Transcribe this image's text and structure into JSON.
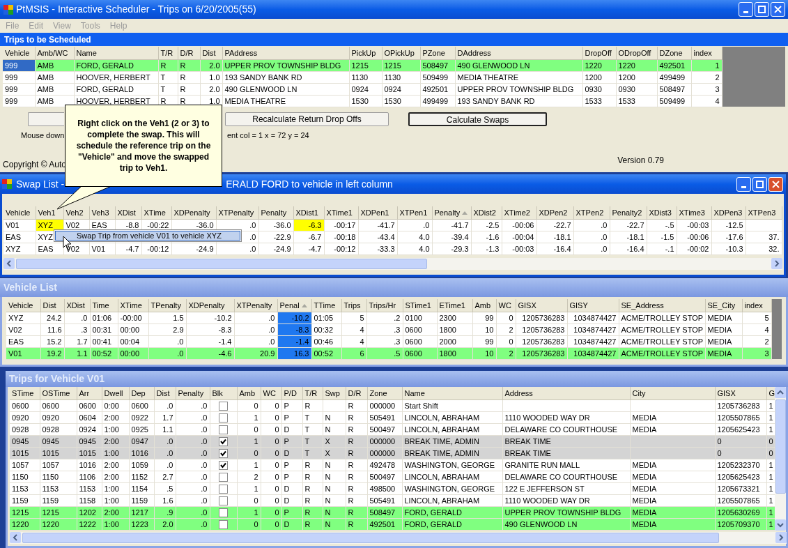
{
  "window": {
    "title": "PtMSIS - Interactive Scheduler - Trips on 6/20/2005(55)"
  },
  "menu": [
    "File",
    "Edit",
    "View",
    "Tools",
    "Help"
  ],
  "trips_to_schedule": {
    "title": "Trips to be Scheduled",
    "columns": [
      "Vehicle",
      "Amb/WC",
      "Name",
      "T/R",
      "D/R",
      "Dist",
      "PAddress",
      "PickUp",
      "OPickUp",
      "PZone",
      "DAddress",
      "DropOff",
      "ODropOff",
      "DZone",
      "index"
    ],
    "rows": [
      {
        "selected": true,
        "cells": [
          "999",
          "AMB",
          "FORD, GERALD",
          "R",
          "R",
          "2.0",
          "UPPER PROV TOWNSHIP BLDG",
          "1215",
          "1215",
          "508497",
          "490 GLENWOOD LN",
          "1220",
          "1220",
          "492501",
          "1"
        ]
      },
      {
        "selected": false,
        "cells": [
          "999",
          "AMB",
          "HOOVER, HERBERT",
          "T",
          "R",
          "1.0",
          "193 SANDY BANK RD",
          "1130",
          "1130",
          "509499",
          "MEDIA THEATRE",
          "1200",
          "1200",
          "499499",
          "2"
        ]
      },
      {
        "selected": false,
        "cells": [
          "999",
          "AMB",
          "FORD, GERALD",
          "T",
          "R",
          "2.0",
          "490 GLENWOOD LN",
          "0924",
          "0924",
          "492501",
          "UPPER PROV TOWNSHIP BLDG",
          "0930",
          "0930",
          "508497",
          "3"
        ]
      },
      {
        "selected": false,
        "cells": [
          "999",
          "AMB",
          "HOOVER, HERBERT",
          "R",
          "R",
          "1.0",
          "MEDIA THEATRE",
          "1530",
          "1530",
          "499499",
          "193 SANDY BANK RD",
          "1533",
          "1533",
          "509499",
          "4"
        ]
      }
    ]
  },
  "buttons": [
    {
      "label": "Recalculate Return Drop Offs",
      "default": false
    },
    {
      "label": "Calculate Swaps",
      "default": true
    }
  ],
  "status_text": [
    "Mouse down",
    "ent col = 1 x = 72 y = 24"
  ],
  "copyright": "Copyright © Auto",
  "version": "Version 0.79",
  "callout": "Right click on the Veh1 (2 or 3) to complete the swap.  This will schedule the reference trip on the \"Vehicle\" and move the swapped trip to Veh1.",
  "swap_list": {
    "title_start": "Swap List -",
    "title_end": "ERALD FORD to vehicle in left column",
    "columns": [
      {
        "label": "Vehicle",
        "sorted": false
      },
      {
        "label": "Veh1",
        "sorted": false
      },
      {
        "label": "Veh2",
        "sorted": false
      },
      {
        "label": "Veh3",
        "sorted": false
      },
      {
        "label": "XDist",
        "sorted": false
      },
      {
        "label": "XTime",
        "sorted": false
      },
      {
        "label": "XDPenalty",
        "sorted": false
      },
      {
        "label": "XTPenalty",
        "sorted": false
      },
      {
        "label": "Penalty",
        "sorted": false
      },
      {
        "label": "XDist1",
        "sorted": false
      },
      {
        "label": "XTime1",
        "sorted": false
      },
      {
        "label": "XDPen1",
        "sorted": false
      },
      {
        "label": "XTPen1",
        "sorted": false
      },
      {
        "label": "Penalty",
        "sorted": true
      },
      {
        "label": "XDist2",
        "sorted": false
      },
      {
        "label": "XTime2",
        "sorted": false
      },
      {
        "label": "XDPen2",
        "sorted": false
      },
      {
        "label": "XTPen2",
        "sorted": false
      },
      {
        "label": "Penalty2",
        "sorted": false
      },
      {
        "label": "XDist3",
        "sorted": false
      },
      {
        "label": "XTime3",
        "sorted": false
      },
      {
        "label": "XDPen3",
        "sorted": false
      },
      {
        "label": "XTPen3",
        "sorted": false
      }
    ],
    "rows": [
      {
        "marked": [
          false,
          true,
          false,
          false,
          false,
          false,
          false,
          false,
          false,
          true,
          false,
          false,
          false,
          false,
          false,
          false,
          false,
          false,
          false,
          false,
          false,
          false,
          false
        ],
        "cells": [
          "V01",
          "XYZ",
          "V02",
          "EAS",
          "-8.8",
          "-00:22",
          "-36.0",
          ".0",
          "-36.0",
          "-6.3",
          "-00:17",
          "-41.7",
          ".0",
          "-41.7",
          "-2.5",
          "-00:06",
          "-22.7",
          ".0",
          "-22.7",
          "-.5",
          "-00:03",
          "-12.5",
          null
        ]
      },
      {
        "marked": [
          false,
          false,
          false,
          false,
          false,
          false,
          false,
          false,
          false,
          false,
          false,
          false,
          false,
          false,
          false,
          false,
          false,
          false,
          false,
          false,
          false,
          false,
          false
        ],
        "cells": [
          "EAS",
          "XYZ",
          null,
          null,
          null,
          null,
          null,
          ".0",
          "-22.9",
          "-6.7",
          "-00:18",
          "-43.4",
          "4.0",
          "-39.4",
          "-1.6",
          "-00:04",
          "-18.1",
          ".0",
          "-18.1",
          "-1.5",
          "-00:06",
          "-17.6",
          "37."
        ]
      },
      {
        "marked": [
          false,
          false,
          false,
          false,
          false,
          false,
          false,
          false,
          false,
          false,
          false,
          false,
          false,
          false,
          false,
          false,
          false,
          false,
          false,
          false,
          false,
          false,
          false
        ],
        "cells": [
          "XYZ",
          "EAS",
          "V02",
          "V01",
          "-4.7",
          "-00:12",
          "-24.9",
          ".0",
          "-24.9",
          "-4.7",
          "-00:12",
          "-33.3",
          "4.0",
          "-29.3",
          "-1.3",
          "-00:03",
          "-16.4",
          ".0",
          "-16.4",
          "-.1",
          "-00:02",
          "-10.3",
          "32."
        ]
      }
    ]
  },
  "context_menu": {
    "item": "Swap Trip from vehicle V01 to vehicle XYZ"
  },
  "vehicle_list": {
    "title": "Vehicle List",
    "columns": [
      {
        "label": "Vehicle",
        "sorted": false,
        "selected": false
      },
      {
        "label": "Dist",
        "sorted": false,
        "selected": false
      },
      {
        "label": "XDist",
        "sorted": false,
        "selected": false
      },
      {
        "label": "Time",
        "sorted": false,
        "selected": false
      },
      {
        "label": "XTime",
        "sorted": false,
        "selected": false
      },
      {
        "label": "TPenalty",
        "sorted": false,
        "selected": false
      },
      {
        "label": "XDPenalty",
        "sorted": false,
        "selected": false
      },
      {
        "label": "XTPenalty",
        "sorted": false,
        "selected": false
      },
      {
        "label": "Penal",
        "sorted": true,
        "selected": true
      },
      {
        "label": "TTime",
        "sorted": false,
        "selected": false
      },
      {
        "label": "Trips",
        "sorted": false,
        "selected": false
      },
      {
        "label": "Trips/Hr",
        "sorted": false,
        "selected": false
      },
      {
        "label": "STime1",
        "sorted": false,
        "selected": false
      },
      {
        "label": "ETime1",
        "sorted": false,
        "selected": false
      },
      {
        "label": "Amb",
        "sorted": false,
        "selected": false
      },
      {
        "label": "WC",
        "sorted": false,
        "selected": false
      },
      {
        "label": "GISX",
        "sorted": false,
        "selected": false
      },
      {
        "label": "GISY",
        "sorted": false,
        "selected": false
      },
      {
        "label": "SE_Address",
        "sorted": false,
        "selected": false
      },
      {
        "label": "SE_City",
        "sorted": false,
        "selected": false
      },
      {
        "label": "index",
        "sorted": false,
        "selected": false
      }
    ],
    "rows": [
      {
        "selected": false,
        "cells": [
          "XYZ",
          "24.2",
          ".0",
          "01:06",
          "-00:00",
          "1.5",
          "-10.2",
          ".0",
          "-10.2",
          "01:05",
          "5",
          ".2",
          "0100",
          "2300",
          "99",
          "0",
          "1205736283",
          "1034874427",
          "ACME/TROLLEY STOP",
          "MEDIA",
          "5"
        ]
      },
      {
        "selected": false,
        "cells": [
          "V02",
          "11.6",
          ".3",
          "00:31",
          "00:00",
          "2.9",
          "-8.3",
          ".0",
          "-8.3",
          "00:32",
          "4",
          ".3",
          "0600",
          "1800",
          "10",
          "2",
          "1205736283",
          "1034874427",
          "ACME/TROLLEY STOP",
          "MEDIA",
          "4"
        ]
      },
      {
        "selected": false,
        "cells": [
          "EAS",
          "15.2",
          "1.7",
          "00:41",
          "00:04",
          ".0",
          "-1.4",
          ".0",
          "-1.4",
          "00:46",
          "4",
          ".3",
          "0600",
          "2000",
          "99",
          "0",
          "1205736283",
          "1034874427",
          "ACME/TROLLEY STOP",
          "MEDIA",
          "2"
        ]
      },
      {
        "selected": true,
        "cells": [
          "V01",
          "19.2",
          "1.1",
          "00:52",
          "00:00",
          ".0",
          "-4.6",
          "20.9",
          "16.3",
          "00:52",
          "6",
          ".5",
          "0600",
          "1800",
          "10",
          "2",
          "1205736283",
          "1034874427",
          "ACME/TROLLEY STOP",
          "MEDIA",
          "3"
        ]
      }
    ]
  },
  "vehicle_trips": {
    "title": "Trips for Vehicle V01",
    "columns": [
      "STime",
      "OSTime",
      "Arr",
      "Dwell",
      "Dep",
      "Dist",
      "Penalty",
      "Blk",
      "Amb",
      "WC",
      "P/D",
      "T/R",
      "Swp",
      "D/R",
      "Zone",
      "Name",
      "Address",
      "City",
      "GISX",
      "G"
    ],
    "rows": [
      {
        "kind": "trip",
        "blocked": false,
        "cells": [
          "0600",
          "0600",
          "0600",
          "0:00",
          "0600",
          ".0",
          ".0",
          "",
          "0",
          "0",
          "P",
          "R",
          null,
          "R",
          "000000",
          "Start Shift",
          null,
          null,
          "1205736283",
          "1"
        ]
      },
      {
        "kind": "trip",
        "blocked": false,
        "cells": [
          "0920",
          "0920",
          "0604",
          "2:00",
          "0922",
          "1.7",
          ".0",
          "",
          "1",
          "0",
          "P",
          "T",
          "N",
          "R",
          "505491",
          "LINCOLN, ABRAHAM",
          "1110 WOODED WAY DR",
          "MEDIA",
          "1205507865",
          "1"
        ]
      },
      {
        "kind": "trip",
        "blocked": false,
        "cells": [
          "0928",
          "0928",
          "0924",
          "1:00",
          "0925",
          "1.1",
          ".0",
          "",
          "0",
          "0",
          "D",
          "T",
          "N",
          "R",
          "500497",
          "LINCOLN, ABRAHAM",
          "DELAWARE CO COURTHOUSE",
          "MEDIA",
          "1205625423",
          "1"
        ]
      },
      {
        "kind": "break",
        "blocked": true,
        "cells": [
          "0945",
          "0945",
          "0945",
          "2:00",
          "0947",
          ".0",
          ".0",
          "",
          "1",
          "0",
          "P",
          "T",
          "X",
          "R",
          "000000",
          "BREAK TIME, ADMIN",
          "BREAK TIME",
          null,
          "0",
          "0"
        ]
      },
      {
        "kind": "break",
        "blocked": true,
        "cells": [
          "1015",
          "1015",
          "1015",
          "1:00",
          "1016",
          ".0",
          ".0",
          "",
          "0",
          "0",
          "D",
          "T",
          "X",
          "R",
          "000000",
          "BREAK TIME, ADMIN",
          "BREAK TIME",
          null,
          "0",
          "0"
        ]
      },
      {
        "kind": "trip",
        "blocked": true,
        "cells": [
          "1057",
          "1057",
          "1016",
          "2:00",
          "1059",
          ".0",
          ".0",
          "",
          "1",
          "0",
          "P",
          "R",
          "N",
          "R",
          "492478",
          "WASHINGTON, GEORGE",
          "GRANITE RUN MALL",
          "MEDIA",
          "1205232370",
          "1"
        ]
      },
      {
        "kind": "trip",
        "blocked": false,
        "cells": [
          "1150",
          "1150",
          "1106",
          "2:00",
          "1152",
          "2.7",
          ".0",
          "",
          "2",
          "0",
          "P",
          "R",
          "N",
          "R",
          "500497",
          "LINCOLN, ABRAHAM",
          "DELAWARE CO COURTHOUSE",
          "MEDIA",
          "1205625423",
          "1"
        ]
      },
      {
        "kind": "trip",
        "blocked": false,
        "cells": [
          "1153",
          "1153",
          "1153",
          "1:00",
          "1154",
          ".5",
          ".0",
          "",
          "1",
          "0",
          "D",
          "R",
          "N",
          "R",
          "498500",
          "WASHINGTON, GEORGE",
          "122 E JEFFERSON ST",
          "MEDIA",
          "1205673321",
          "1"
        ]
      },
      {
        "kind": "trip",
        "blocked": false,
        "cells": [
          "1159",
          "1159",
          "1158",
          "1:00",
          "1159",
          "1.6",
          ".0",
          "",
          "0",
          "0",
          "D",
          "R",
          "N",
          "R",
          "505491",
          "LINCOLN, ABRAHAM",
          "1110 WOODED WAY DR",
          "MEDIA",
          "1205507865",
          "1"
        ]
      },
      {
        "kind": "assigned",
        "blocked": false,
        "cells": [
          "1215",
          "1215",
          "1202",
          "2:00",
          "1217",
          ".9",
          ".0",
          "",
          "1",
          "0",
          "P",
          "R",
          "N",
          "R",
          "508497",
          "FORD, GERALD",
          "UPPER PROV TOWNSHIP BLDG",
          "MEDIA",
          "1205630269",
          "1"
        ]
      },
      {
        "kind": "assigned",
        "blocked": false,
        "cells": [
          "1220",
          "1220",
          "1222",
          "1:00",
          "1223",
          "2.0",
          ".0",
          "",
          "0",
          "0",
          "D",
          "R",
          "N",
          "R",
          "492501",
          "FORD, GERALD",
          "490 GLENWOOD LN",
          "MEDIA",
          "1205709370",
          "1"
        ]
      }
    ]
  }
}
